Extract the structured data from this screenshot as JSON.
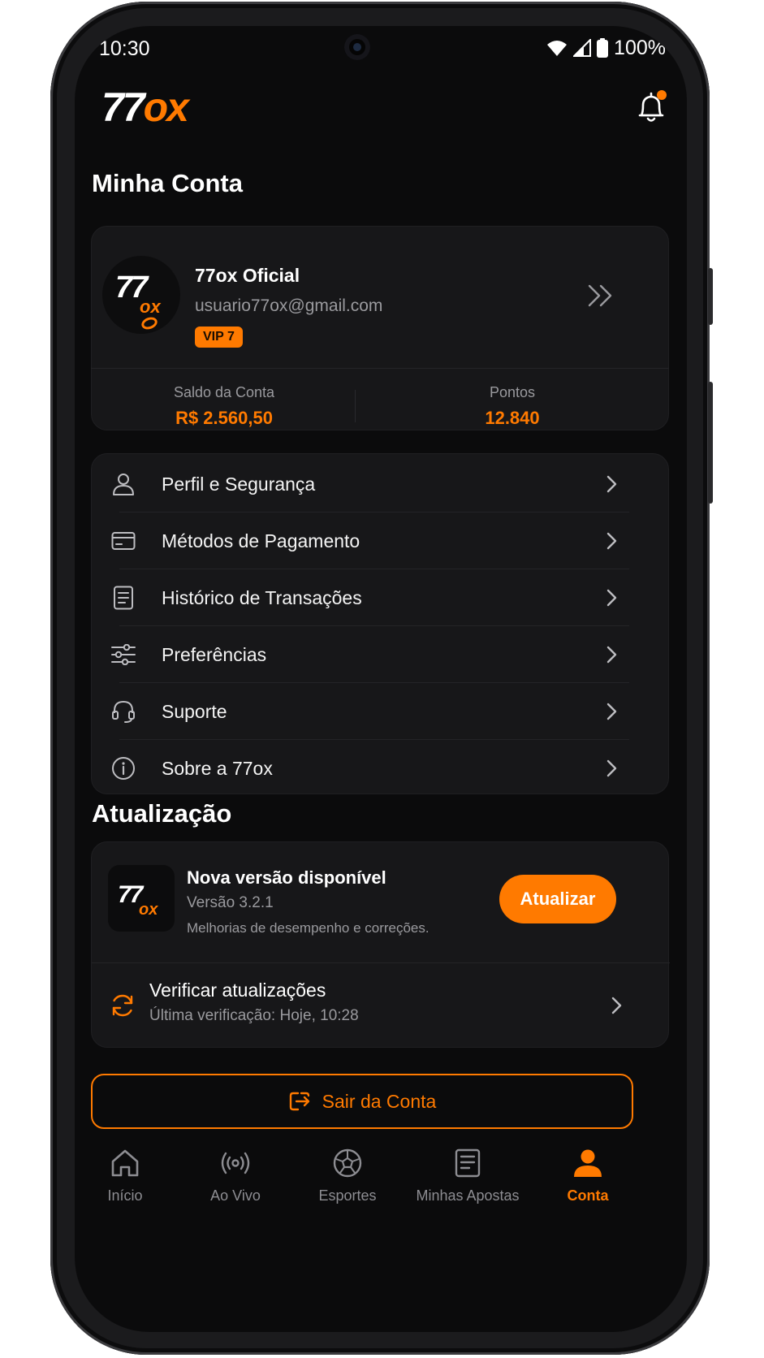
{
  "status_bar": {
    "time": "10:30",
    "battery": "100%"
  },
  "header": {
    "logo_white": "77",
    "logo_orange": "ox"
  },
  "account": {
    "section_title": "Minha Conta",
    "avatar_number": "77",
    "avatar_suffix": "ox",
    "name": "77ox Oficial",
    "email": "usuario77ox@gmail.com",
    "vip": "VIP 7",
    "balance_label": "Saldo da Conta",
    "balance_value": "R$ 2.560,50",
    "points_label": "Pontos",
    "points_value": "12.840"
  },
  "menu": [
    {
      "label": "Perfil e Segurança",
      "icon": "user-icon"
    },
    {
      "label": "Métodos de Pagamento",
      "icon": "credit-card-icon"
    },
    {
      "label": "Histórico de Transações",
      "icon": "document-icon"
    },
    {
      "label": "Preferências",
      "icon": "sliders-icon"
    },
    {
      "label": "Suporte",
      "icon": "headset-icon"
    },
    {
      "label": "Sobre a 77ox",
      "icon": "info-icon"
    }
  ],
  "update": {
    "section_title": "Atualização",
    "tile_number": "77",
    "tile_suffix": "ox",
    "title": "Nova versão disponível",
    "version": "Versão 3.2.1",
    "description": "Melhorias de desempenho e correções.",
    "button": "Atualizar",
    "check_title": "Verificar atualizações",
    "check_subtitle": "Última verificação: Hoje, 10:28"
  },
  "logout": {
    "label": "Sair da Conta"
  },
  "tabs": [
    {
      "label": "Início",
      "icon": "home-icon"
    },
    {
      "label": "Ao Vivo",
      "icon": "live-broadcast-icon"
    },
    {
      "label": "Esportes",
      "icon": "soccer-ball-icon"
    },
    {
      "label": "Minhas Apostas",
      "icon": "bet-slip-icon"
    },
    {
      "label": "Conta",
      "icon": "user-filled-icon",
      "active": true
    }
  ],
  "colors": {
    "accent": "#ff7a00",
    "background": "#0b0b0c",
    "card": "#171719",
    "muted": "#9a9a9e"
  }
}
